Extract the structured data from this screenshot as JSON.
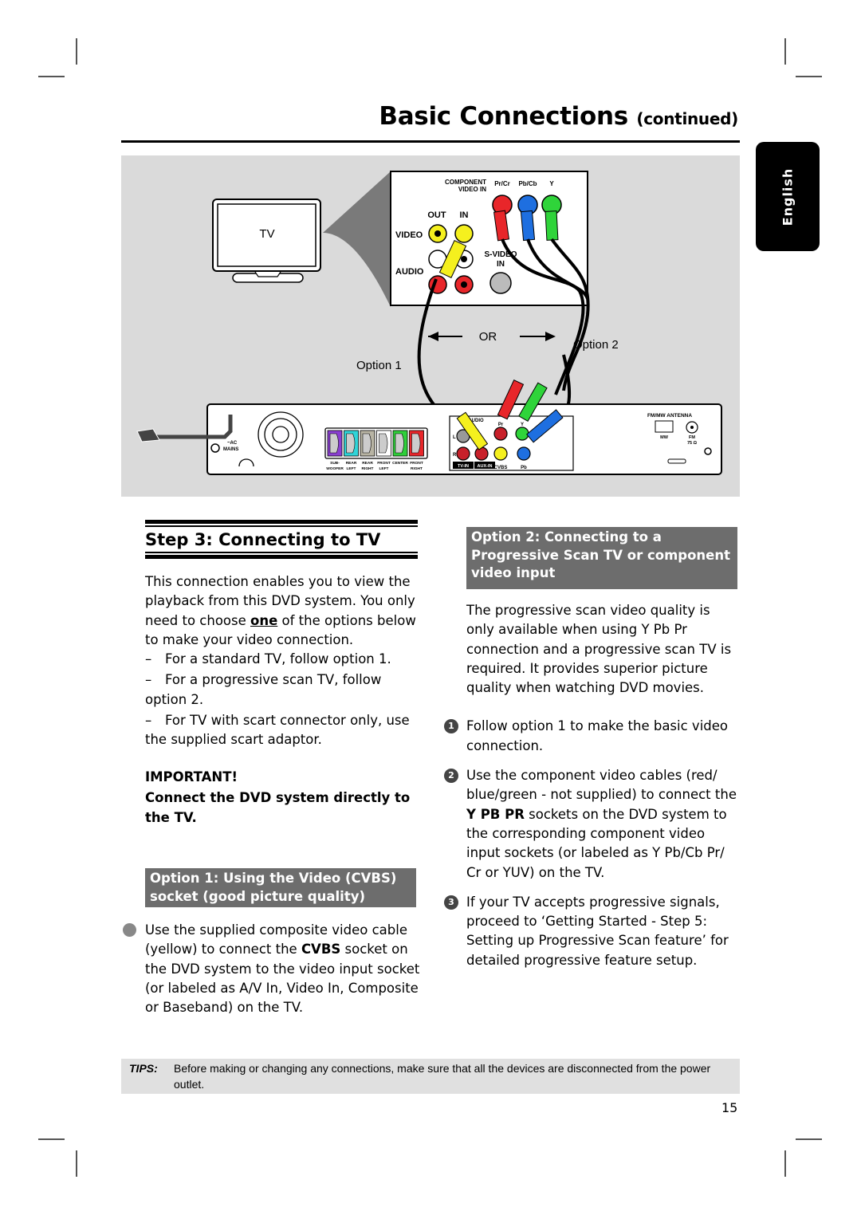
{
  "header": {
    "title": "Basic Connections",
    "title_suffix": "(continued)"
  },
  "language_tab": "English",
  "diagram": {
    "tv_label": "TV",
    "or_label": "OR",
    "option1_label": "Option 1",
    "option2_label": "Option 2",
    "tv_panel": {
      "component_label_line1": "COMPONENT",
      "component_label_line2": "VIDEO IN",
      "pr_label": "Pr/Cr",
      "pb_label": "Pb/Cb",
      "y_label": "Y",
      "out_label": "OUT",
      "in_label": "IN",
      "video_label": "VIDEO",
      "audio_label": "AUDIO",
      "svideo_label_line1": "S-VIDEO",
      "svideo_label_line2": "IN"
    },
    "dvd_panel": {
      "ac_mains_line1": "~AC",
      "ac_mains_line2": "MAINS",
      "speaker_labels": [
        {
          "line1": "SUB-",
          "line2": "WOOFER",
          "color": "#8a3fd1"
        },
        {
          "line1": "REAR",
          "line2": "LEFT",
          "color": "#2fd4d8"
        },
        {
          "line1": "REAR",
          "line2": "RIGHT",
          "color": "#b8b4a4"
        },
        {
          "line1": "FRONT",
          "line2": "LEFT",
          "color": "#ffffff"
        },
        {
          "line1": "CENTER",
          "line2": "",
          "color": "#2fcf3a"
        },
        {
          "line1": "FRONT",
          "line2": "RIGHT",
          "color": "#e8262a"
        }
      ],
      "audio_label": "AUDIO",
      "l_label": "L",
      "r_label": "R",
      "tv_in_label": "TV-IN",
      "aux_in_label": "AUX-IN",
      "cvbs_label": "CVBS",
      "pr_label": "Pr",
      "y_label": "Y",
      "pb_label": "Pb",
      "antenna_label": "FM/MW ANTENNA",
      "mw_label": "MW",
      "fm_label_line1": "FM",
      "fm_label_line2": "75 Ω"
    }
  },
  "step": {
    "heading": "Step 3:  Connecting to TV",
    "intro_before": "This connection enables you to view the playback from this DVD system. You only need to choose ",
    "intro_emphasis": "one",
    "intro_after": " of the options below to make your video connection.",
    "dash_items": [
      "For a standard TV, follow option 1.",
      "For a progressive scan TV, follow option 2.",
      "For TV with scart connector only, use the supplied scart adaptor."
    ],
    "important_title": "IMPORTANT!",
    "important_text": "Connect the DVD system directly to the TV."
  },
  "option1": {
    "heading": "Option 1: Using the Video (CVBS) socket (good picture quality)",
    "bullet_before": "Use the supplied composite video cable (yellow) to connect the ",
    "bullet_bold": "CVBS",
    "bullet_after": " socket on the DVD system to the video input socket (or labeled as A/V In, Video In, Composite or Baseband) on the TV."
  },
  "option2": {
    "heading": "Option 2: Connecting to a Progressive Scan TV or component video input",
    "intro": "The progressive scan video quality is only available when using Y Pb Pr connection and a progressive scan TV is required. It provides superior picture quality when watching DVD movies.",
    "steps": [
      {
        "num": "1",
        "text": "Follow option 1 to make the basic video connection."
      },
      {
        "num": "2",
        "before": "Use the component video cables (red/ blue/green - not supplied) to connect the ",
        "bold": "Y PB PR",
        "after": " sockets on the DVD system to the corresponding component video input sockets (or labeled as Y Pb/Cb Pr/ Cr or YUV) on the TV."
      },
      {
        "num": "3",
        "text": "If your TV accepts progressive signals, proceed to ‘Getting Started - Step 5: Setting up Progressive Scan feature’ for detailed progressive feature setup."
      }
    ]
  },
  "tips": {
    "label": "TIPS:",
    "text": "Before making or changing any connections, make sure that all the devices are disconnected from the power outlet."
  },
  "page_number": "15",
  "colors": {
    "diagram_bg": "#dadada",
    "option_box_bg": "#6d6d6d",
    "tips_bg": "#e0e0e0",
    "cable_red": "#e8262a",
    "cable_blue": "#1e6fe0",
    "cable_green": "#2fd43a",
    "cable_yellow": "#f5f01e"
  }
}
